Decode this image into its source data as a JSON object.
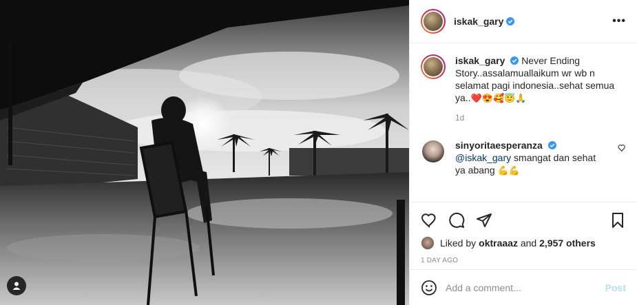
{
  "post": {
    "username": "iskak_gary",
    "more_icon": "more-horizontal-icon",
    "more_label": "•••",
    "caption": {
      "username": "iskak_gary",
      "text": "Never Ending Story..assalamuallaikum wr wb n selamat pagi indonesia..sehat semua ya..",
      "emojis": "❤️😍🥰😇🙏",
      "time": "1d"
    },
    "comments": [
      {
        "username": "sinyoritaesperanza",
        "mention": "@iskak_gary",
        "text": " smangat dan sehat ya abang ",
        "emojis": "💪💪"
      }
    ],
    "likes": {
      "prefix": "Liked by ",
      "user": "oktraaaz",
      "middle": " and ",
      "count": "2,957 others"
    },
    "timestamp": "1 DAY AGO",
    "add_comment": {
      "placeholder": "Add a comment...",
      "post_label": "Post"
    }
  },
  "colors": {
    "verified": "#3897f0",
    "post_button": "#b2dffc",
    "secondary_text": "#8e8e8e"
  },
  "icons": [
    "user-tag-icon",
    "heart-icon",
    "comment-icon",
    "share-icon",
    "bookmark-icon",
    "emoji-icon",
    "verified-badge-icon"
  ]
}
